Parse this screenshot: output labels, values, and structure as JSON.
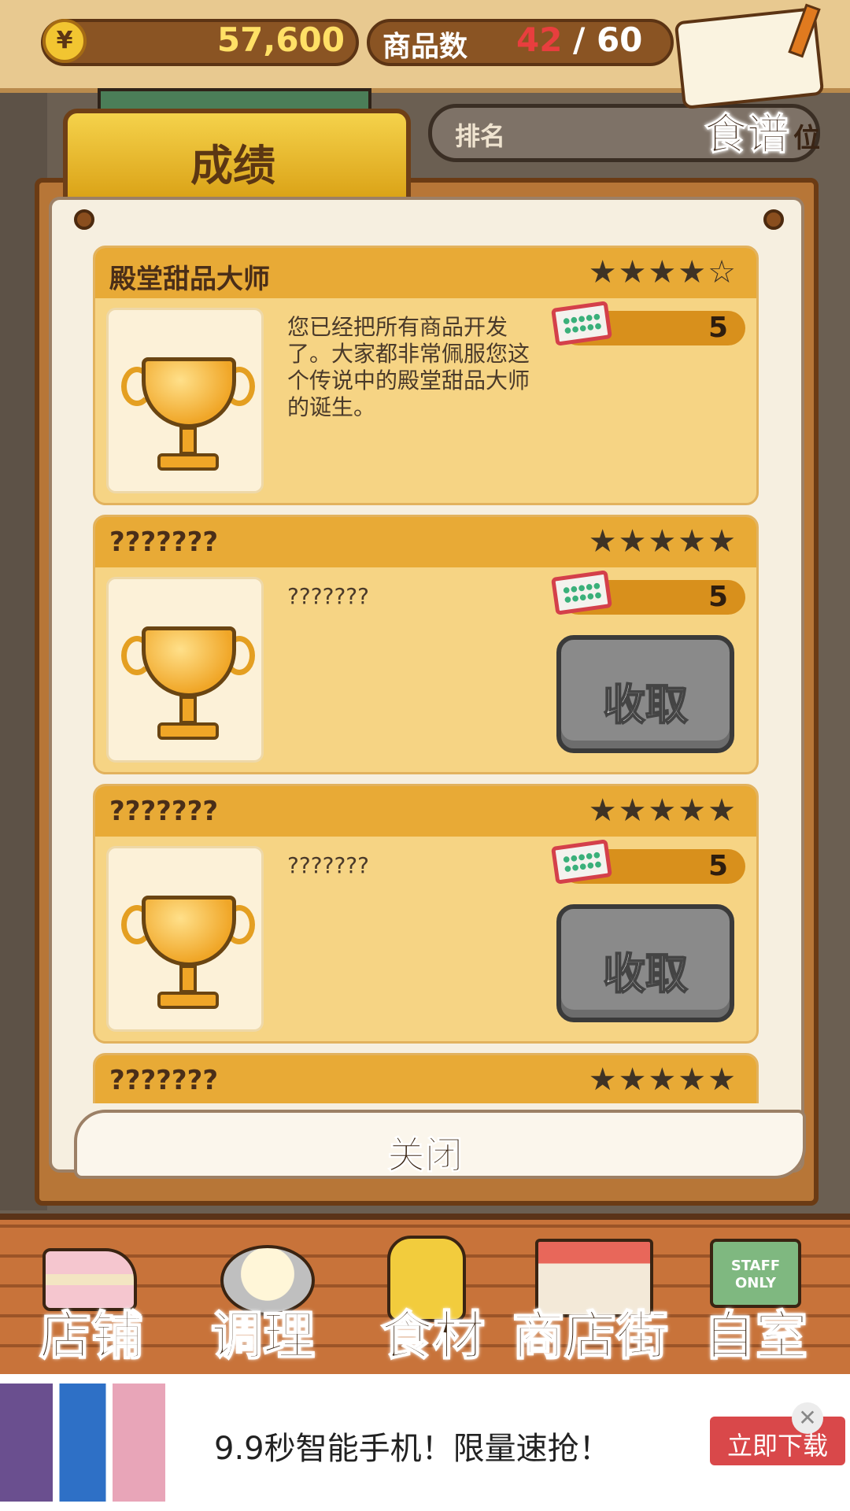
{
  "hud": {
    "coin_symbol": "¥",
    "money": "57,600",
    "product_count_label": "商品数",
    "product_count_current": "42",
    "product_count_total": "/ 60",
    "recipe_button_label": "食谱",
    "rank_label": "排名",
    "rank_suffix": "位"
  },
  "panel": {
    "tab_label": "成绩",
    "close_label": "关闭"
  },
  "achievements": [
    {
      "title": "殿堂甜品大师",
      "stars": "★★★★☆",
      "description": "您已经把所有商品开发了。大家都非常佩服您这个传说中的殿堂甜品大师的诞生。",
      "reward": "5",
      "collect_label": ""
    },
    {
      "title": "???????",
      "stars": "★★★★★",
      "description": "???????",
      "reward": "5",
      "collect_label": "收取"
    },
    {
      "title": "???????",
      "stars": "★★★★★",
      "description": "???????",
      "reward": "5",
      "collect_label": "收取"
    },
    {
      "title": "???????",
      "stars": "★★★★★",
      "description": "",
      "reward": "",
      "collect_label": ""
    }
  ],
  "nav": {
    "shop": "店铺",
    "cook": "调理",
    "ingredients": "食材",
    "street": "商店街",
    "room": "自室",
    "room_sign": "STAFF ONLY"
  },
  "ad": {
    "text": "9.9秒智能手机！限量速抢！",
    "button": "立即下载",
    "close": "✕"
  },
  "colors": {
    "card_header": "#e8aa36",
    "card_body": "#f6d484",
    "collect_button": "#8a8a8a",
    "board": "#b77637",
    "ad_button": "#d9484a"
  }
}
